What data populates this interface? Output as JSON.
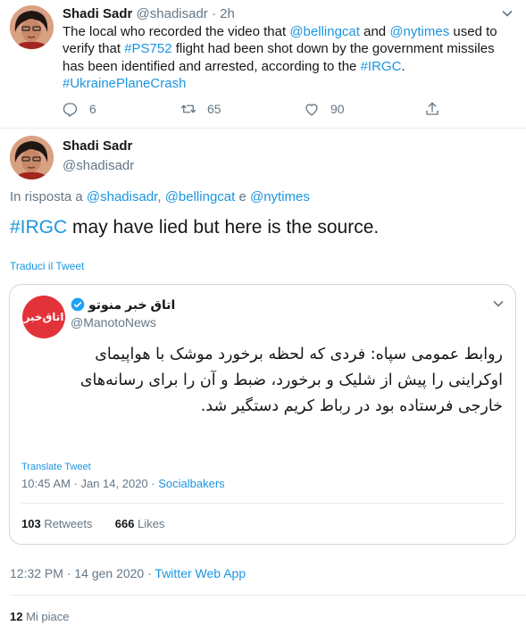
{
  "tweet1": {
    "name": "Shadi Sadr",
    "handle": "@shadisadr",
    "age": "2h",
    "text_parts": [
      "The local who recorded the video that ",
      "@bellingcat",
      " and ",
      "@nytimes",
      " used to verify that ",
      "#PS752",
      " flight had been shot down by the government missiles has been identified and arrested, according to the ",
      "#IRGC",
      ".",
      "#UkrainePlaneCrash"
    ],
    "replies": "6",
    "retweets": "65",
    "likes": "90"
  },
  "tweet2": {
    "name": "Shadi Sadr",
    "handle": "@shadisadr",
    "reply_prefix": "In risposta a ",
    "reply_user1": "@shadisadr",
    "reply_sep": ", ",
    "reply_user2": "@bellingcat",
    "reply_and": " e ",
    "reply_user3": "@nytimes",
    "hashtag": "#IRGC",
    "text": " may have lied but here is the source.",
    "translate_label": "Traduci il Tweet"
  },
  "quoted": {
    "name": "اتاق خبر منوتو",
    "handle": "@ManotoNews",
    "logo_text": "اتاق‌خبر",
    "body": "روابط عمومی سپاه: فردی که لحظه برخورد موشک با هواپیمای اوکراینی را پیش از شلیک و برخورد، ضبط و آن را برای رسانه‌های خارجی فرستاده بود در رباط کریم دستگیر شد.",
    "translate_label": "Translate Tweet",
    "time": "10:45 AM · Jan 14, 2020 · ",
    "source": "Socialbakers",
    "retweets_count": "103",
    "retweets_label": " Retweets",
    "likes_count": "666",
    "likes_label": " Likes"
  },
  "footer": {
    "time": "12:32 PM · 14 gen 2020 · ",
    "source": "Twitter Web App",
    "likes_count": "12",
    "likes_label": " Mi piace"
  },
  "colors": {
    "link": "#1b95e0",
    "muted": "#657786",
    "text": "#14171a",
    "logo": "#e3333a"
  }
}
